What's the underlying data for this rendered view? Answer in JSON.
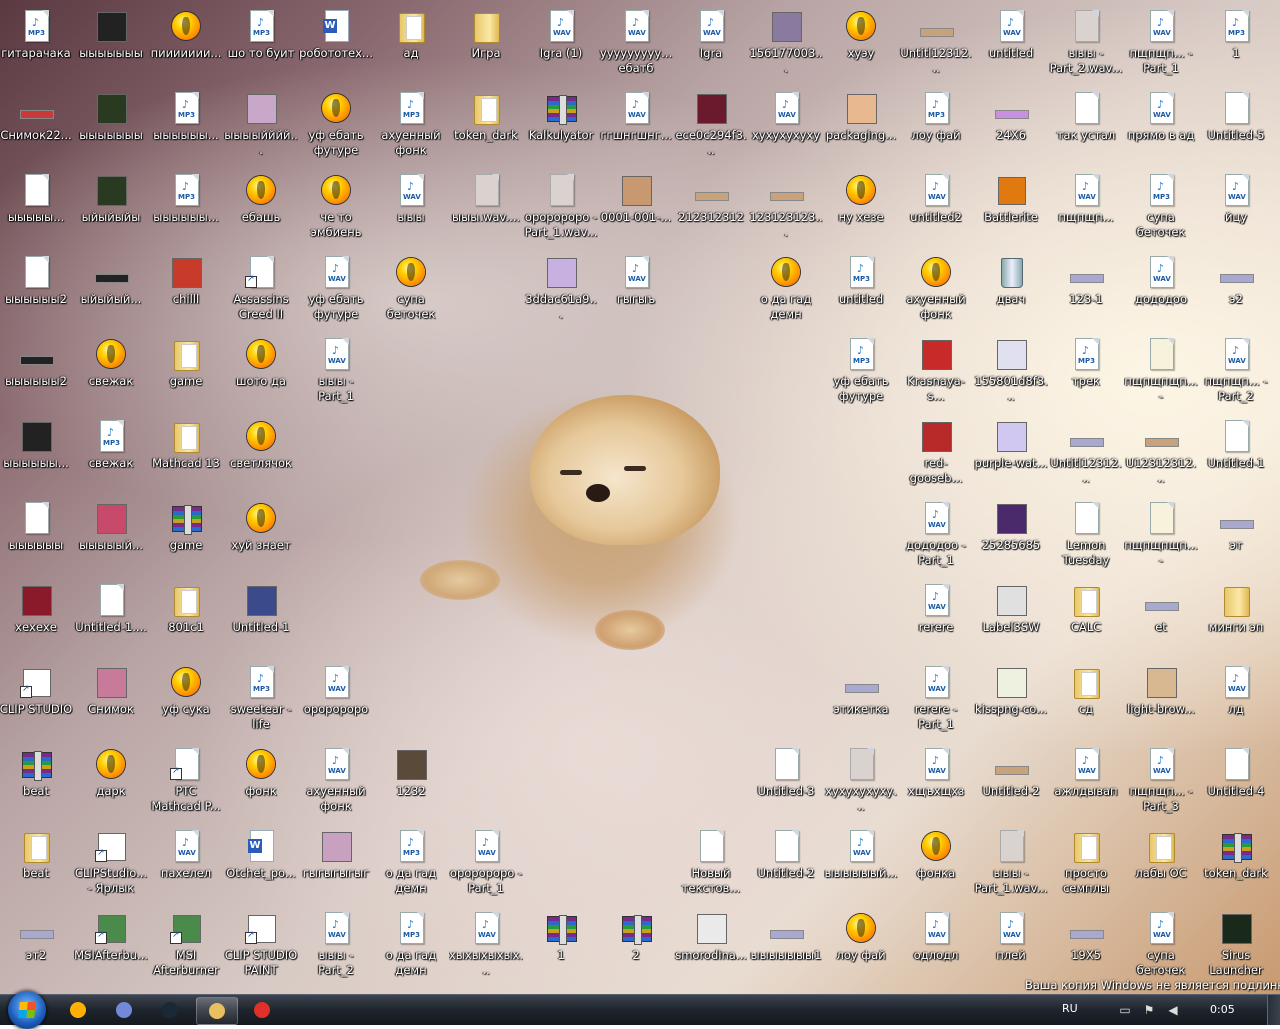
{
  "desktop": {
    "icons": [
      {
        "col": 0,
        "row": 0,
        "label": "гитарачака",
        "type": "mp3"
      },
      {
        "col": 1,
        "row": 0,
        "label": "ыыыыыыы",
        "type": "thumb",
        "color": "#222"
      },
      {
        "col": 2,
        "row": 0,
        "label": "пиииииии...",
        "type": "fl"
      },
      {
        "col": 3,
        "row": 0,
        "label": "шо то буит",
        "type": "mp3"
      },
      {
        "col": 4,
        "row": 0,
        "label": "робототех...",
        "type": "word"
      },
      {
        "col": 5,
        "row": 0,
        "label": "ад",
        "type": "folder-open"
      },
      {
        "col": 6,
        "row": 0,
        "label": "Игра",
        "type": "folder"
      },
      {
        "col": 7,
        "row": 0,
        "label": "Igra (1)",
        "type": "wav"
      },
      {
        "col": 8,
        "row": 0,
        "label": "ууууууууу... ебатб",
        "type": "wav"
      },
      {
        "col": 9,
        "row": 0,
        "label": "Igra",
        "type": "wav"
      },
      {
        "col": 10,
        "row": 0,
        "label": "156177003...",
        "type": "thumb",
        "color": "#8a7aa0"
      },
      {
        "col": 11,
        "row": 0,
        "label": "хуэу",
        "type": "fl"
      },
      {
        "col": 12,
        "row": 0,
        "label": "Untitl12312...",
        "type": "strip",
        "color": "#c8a27a"
      },
      {
        "col": 13,
        "row": 0,
        "label": "untitled",
        "type": "wav"
      },
      {
        "col": 14,
        "row": 0,
        "label": "ыыы - Part_2.wav....",
        "type": "doc-gray"
      },
      {
        "col": 15,
        "row": 0,
        "label": "пщпщп... - Part_1",
        "type": "wav"
      },
      {
        "col": 16,
        "row": 0,
        "label": "1",
        "type": "mp3"
      },
      {
        "col": 0,
        "row": 1,
        "label": "Снимок22...",
        "type": "strip",
        "color": "#c83a3a"
      },
      {
        "col": 1,
        "row": 1,
        "label": "ыыыыыыы",
        "type": "thumb",
        "color": "#2a3a20"
      },
      {
        "col": 2,
        "row": 1,
        "label": "ыыыыыы...",
        "type": "mp3"
      },
      {
        "col": 3,
        "row": 1,
        "label": "ыыыыйййй...",
        "type": "thumb",
        "color": "#c8a8c8"
      },
      {
        "col": 4,
        "row": 1,
        "label": "уф ебать футуре трап",
        "type": "fl"
      },
      {
        "col": 5,
        "row": 1,
        "label": "ахуенный фонк",
        "type": "mp3"
      },
      {
        "col": 6,
        "row": 1,
        "label": "token_dark",
        "type": "folder-open"
      },
      {
        "col": 7,
        "row": 1,
        "label": "Kalkulyator",
        "type": "rar"
      },
      {
        "col": 8,
        "row": 1,
        "label": "ггшнгшнг...",
        "type": "wav"
      },
      {
        "col": 9,
        "row": 1,
        "label": "ece0c294f3...",
        "type": "thumb",
        "color": "#6a1a2a"
      },
      {
        "col": 10,
        "row": 1,
        "label": "хухухухуху",
        "type": "wav"
      },
      {
        "col": 11,
        "row": 1,
        "label": "packaging...",
        "type": "thumb",
        "color": "#e8b890"
      },
      {
        "col": 12,
        "row": 1,
        "label": "лоу фай",
        "type": "mp3"
      },
      {
        "col": 13,
        "row": 1,
        "label": "24X6",
        "type": "strip",
        "color": "#c890e0"
      },
      {
        "col": 14,
        "row": 1,
        "label": "так устал",
        "type": "doc"
      },
      {
        "col": 15,
        "row": 1,
        "label": "прямо в ад",
        "type": "wav"
      },
      {
        "col": 16,
        "row": 1,
        "label": "Untitled-5",
        "type": "doc"
      },
      {
        "col": 0,
        "row": 2,
        "label": "ыыыыы...",
        "type": "doc"
      },
      {
        "col": 1,
        "row": 2,
        "label": "ыйыйыйы",
        "type": "thumb",
        "color": "#2a3a20"
      },
      {
        "col": 2,
        "row": 2,
        "label": "ыыыыыы...",
        "type": "mp3"
      },
      {
        "col": 3,
        "row": 2,
        "label": "ебашь",
        "type": "fl"
      },
      {
        "col": 4,
        "row": 2,
        "label": "че то эмбиень",
        "type": "fl"
      },
      {
        "col": 5,
        "row": 2,
        "label": "ыыы",
        "type": "wav"
      },
      {
        "col": 6,
        "row": 2,
        "label": "ыыы.wav....",
        "type": "doc-gray"
      },
      {
        "col": 7,
        "row": 2,
        "label": "ороророро - Part_1.wav....",
        "type": "doc-gray"
      },
      {
        "col": 8,
        "row": 2,
        "label": "0001-001-...",
        "type": "thumb",
        "color": "#c89870"
      },
      {
        "col": 9,
        "row": 2,
        "label": "212312312",
        "type": "strip",
        "color": "#c8a27a"
      },
      {
        "col": 10,
        "row": 2,
        "label": "123123123...",
        "type": "strip",
        "color": "#c8a27a"
      },
      {
        "col": 11,
        "row": 2,
        "label": "ну хезе",
        "type": "fl"
      },
      {
        "col": 12,
        "row": 2,
        "label": "untitled2",
        "type": "wav"
      },
      {
        "col": 13,
        "row": 2,
        "label": "Battlerite",
        "type": "exe",
        "color": "#e07a10"
      },
      {
        "col": 14,
        "row": 2,
        "label": "пщпщп...",
        "type": "wav"
      },
      {
        "col": 15,
        "row": 2,
        "label": "супа беточек",
        "type": "mp3"
      },
      {
        "col": 16,
        "row": 2,
        "label": "йцу",
        "type": "wav"
      },
      {
        "col": 0,
        "row": 3,
        "label": "ыыыыыы2",
        "type": "doc"
      },
      {
        "col": 1,
        "row": 3,
        "label": "ыйыйый...",
        "type": "strip",
        "color": "#222"
      },
      {
        "col": 2,
        "row": 3,
        "label": "chilll",
        "type": "thumb",
        "color": "#c83a2a"
      },
      {
        "col": 3,
        "row": 3,
        "label": "Assassins Creed II",
        "type": "shortcut-doc"
      },
      {
        "col": 4,
        "row": 3,
        "label": "уф ебать футуре трап",
        "type": "wav"
      },
      {
        "col": 5,
        "row": 3,
        "label": "супа беточек",
        "type": "fl"
      },
      {
        "col": 7,
        "row": 3,
        "label": "3ddac61a9...",
        "type": "thumb",
        "color": "#c8b0e0"
      },
      {
        "col": 8,
        "row": 3,
        "label": "гыгыъ",
        "type": "wav"
      },
      {
        "col": 10,
        "row": 3,
        "label": "о да гад демн",
        "type": "fl"
      },
      {
        "col": 11,
        "row": 3,
        "label": "untitled",
        "type": "mp3"
      },
      {
        "col": 12,
        "row": 3,
        "label": "ахуенный фонк",
        "type": "fl"
      },
      {
        "col": 13,
        "row": 3,
        "label": "двач",
        "type": "bin"
      },
      {
        "col": 14,
        "row": 3,
        "label": "123-1",
        "type": "strip",
        "color": "#a8a8d0"
      },
      {
        "col": 15,
        "row": 3,
        "label": "дододоо",
        "type": "wav"
      },
      {
        "col": 16,
        "row": 3,
        "label": "э2",
        "type": "strip",
        "color": "#a8a8d0"
      },
      {
        "col": 0,
        "row": 4,
        "label": "ыыыыыы2",
        "type": "strip",
        "color": "#222"
      },
      {
        "col": 1,
        "row": 4,
        "label": "свежак",
        "type": "fl"
      },
      {
        "col": 2,
        "row": 4,
        "label": "game",
        "type": "folder-open"
      },
      {
        "col": 3,
        "row": 4,
        "label": "шото да",
        "type": "fl"
      },
      {
        "col": 4,
        "row": 4,
        "label": "ыыы - Part_1",
        "type": "wav"
      },
      {
        "col": 11,
        "row": 4,
        "label": "уф ебать футуре трап",
        "type": "mp3"
      },
      {
        "col": 12,
        "row": 4,
        "label": "Krasnaya-s...",
        "type": "thumb",
        "color": "#c82a2a"
      },
      {
        "col": 13,
        "row": 4,
        "label": "155801d8f3...",
        "type": "thumb",
        "color": "#e0e0f0"
      },
      {
        "col": 14,
        "row": 4,
        "label": "трек",
        "type": "mp3"
      },
      {
        "col": 15,
        "row": 4,
        "label": "пщпщпщп... - Part_3.wa...",
        "type": "doc-cream"
      },
      {
        "col": 16,
        "row": 4,
        "label": "пщпщп... - Part_2",
        "type": "wav"
      },
      {
        "col": 0,
        "row": 5,
        "label": "ыыыыыы...",
        "type": "thumb",
        "color": "#222"
      },
      {
        "col": 1,
        "row": 5,
        "label": "свежак",
        "type": "mp3"
      },
      {
        "col": 2,
        "row": 5,
        "label": "Mathcad 13",
        "type": "folder-open"
      },
      {
        "col": 3,
        "row": 5,
        "label": "светлячок",
        "type": "fl"
      },
      {
        "col": 12,
        "row": 5,
        "label": "red-gooseb...",
        "type": "thumb",
        "color": "#b82a2a"
      },
      {
        "col": 13,
        "row": 5,
        "label": "purple-wat...",
        "type": "thumb",
        "color": "#d0c8f0"
      },
      {
        "col": 14,
        "row": 5,
        "label": "Untitl12312...",
        "type": "strip",
        "color": "#a8a8d0"
      },
      {
        "col": 15,
        "row": 5,
        "label": "U12312312...",
        "type": "strip",
        "color": "#c8a27a"
      },
      {
        "col": 16,
        "row": 5,
        "label": "Untitled-1",
        "type": "doc"
      },
      {
        "col": 0,
        "row": 6,
        "label": "ыыыыыы",
        "type": "doc"
      },
      {
        "col": 1,
        "row": 6,
        "label": "ыыыыый...",
        "type": "thumb",
        "color": "#c84a6a"
      },
      {
        "col": 2,
        "row": 6,
        "label": "game",
        "type": "rar"
      },
      {
        "col": 3,
        "row": 6,
        "label": "хуй знает",
        "type": "fl"
      },
      {
        "col": 12,
        "row": 6,
        "label": "дододоо - Part_1",
        "type": "wav"
      },
      {
        "col": 13,
        "row": 6,
        "label": "25285685",
        "type": "thumb",
        "color": "#4a2a6a"
      },
      {
        "col": 14,
        "row": 6,
        "label": "Lemon Tuesday",
        "type": "doc"
      },
      {
        "col": 15,
        "row": 6,
        "label": "пщпщпщп... - Part_2.wa...",
        "type": "doc-cream"
      },
      {
        "col": 16,
        "row": 6,
        "label": "эт",
        "type": "strip",
        "color": "#a8a8d0"
      },
      {
        "col": 0,
        "row": 7,
        "label": "хехехе",
        "type": "thumb",
        "color": "#8a1a2a"
      },
      {
        "col": 1,
        "row": 7,
        "label": "Untitled-1....",
        "type": "doc"
      },
      {
        "col": 2,
        "row": 7,
        "label": "801c1",
        "type": "folder-open"
      },
      {
        "col": 3,
        "row": 7,
        "label": "Untitled-1",
        "type": "thumb",
        "color": "#3a4a8a"
      },
      {
        "col": 12,
        "row": 7,
        "label": "rerere",
        "type": "wav"
      },
      {
        "col": 13,
        "row": 7,
        "label": "Label3SW",
        "type": "thumb",
        "color": "#e0e0e0"
      },
      {
        "col": 14,
        "row": 7,
        "label": "CALC",
        "type": "folder-open"
      },
      {
        "col": 15,
        "row": 7,
        "label": "et",
        "type": "strip",
        "color": "#a8a8d0"
      },
      {
        "col": 16,
        "row": 7,
        "label": "минги эп",
        "type": "folder"
      },
      {
        "col": 0,
        "row": 8,
        "label": "CLIP STUDIO",
        "type": "shortcut-exe",
        "color": "#fff"
      },
      {
        "col": 1,
        "row": 8,
        "label": "Снимок",
        "type": "thumb",
        "color": "#c87a9a"
      },
      {
        "col": 2,
        "row": 8,
        "label": "уф сука",
        "type": "fl"
      },
      {
        "col": 3,
        "row": 8,
        "label": "sweetear - life",
        "type": "mp3"
      },
      {
        "col": 4,
        "row": 8,
        "label": "ороророро",
        "type": "wav"
      },
      {
        "col": 11,
        "row": 8,
        "label": "этикетка",
        "type": "strip",
        "color": "#a8a8d0"
      },
      {
        "col": 12,
        "row": 8,
        "label": "rerere - Part_1",
        "type": "wav"
      },
      {
        "col": 13,
        "row": 8,
        "label": "kisspng-co...",
        "type": "thumb",
        "color": "#eef0e0"
      },
      {
        "col": 14,
        "row": 8,
        "label": "сд",
        "type": "folder-open"
      },
      {
        "col": 15,
        "row": 8,
        "label": "light-brow...",
        "type": "thumb",
        "color": "#d8b890"
      },
      {
        "col": 16,
        "row": 8,
        "label": "лд",
        "type": "wav"
      },
      {
        "col": 0,
        "row": 9,
        "label": "beat",
        "type": "rar"
      },
      {
        "col": 1,
        "row": 9,
        "label": "дарк",
        "type": "fl"
      },
      {
        "col": 2,
        "row": 9,
        "label": "PTC Mathcad P...",
        "type": "shortcut-doc"
      },
      {
        "col": 3,
        "row": 9,
        "label": "фонк",
        "type": "fl"
      },
      {
        "col": 4,
        "row": 9,
        "label": "ахуенный фонк",
        "type": "wav"
      },
      {
        "col": 5,
        "row": 9,
        "label": "1232",
        "type": "thumb",
        "color": "#5a4a3a"
      },
      {
        "col": 10,
        "row": 9,
        "label": "Untitled-3",
        "type": "doc"
      },
      {
        "col": 11,
        "row": 9,
        "label": "хухухухуху...",
        "type": "doc-gray"
      },
      {
        "col": 12,
        "row": 9,
        "label": "хщъхщхз",
        "type": "wav"
      },
      {
        "col": 13,
        "row": 9,
        "label": "Untitled-2",
        "type": "strip",
        "color": "#c8a27a"
      },
      {
        "col": 14,
        "row": 9,
        "label": "ажлдывап",
        "type": "wav"
      },
      {
        "col": 15,
        "row": 9,
        "label": "пщпщп... - Part_3",
        "type": "wav"
      },
      {
        "col": 16,
        "row": 9,
        "label": "Untitled-4",
        "type": "doc"
      },
      {
        "col": 0,
        "row": 10,
        "label": "beat",
        "type": "folder-open"
      },
      {
        "col": 1,
        "row": 10,
        "label": "CLIPStudio... - Ярлык",
        "type": "shortcut-exe",
        "color": "#fff"
      },
      {
        "col": 2,
        "row": 10,
        "label": "пахелел",
        "type": "wav"
      },
      {
        "col": 3,
        "row": 10,
        "label": "Otchet_po...",
        "type": "word"
      },
      {
        "col": 4,
        "row": 10,
        "label": "гыгыгыгыг",
        "type": "thumb",
        "color": "#c8a0c0"
      },
      {
        "col": 5,
        "row": 10,
        "label": "о да гад демн",
        "type": "mp3"
      },
      {
        "col": 6,
        "row": 10,
        "label": "ороророро - Part_1",
        "type": "wav"
      },
      {
        "col": 9,
        "row": 10,
        "label": "Новый текстов...",
        "type": "doc"
      },
      {
        "col": 10,
        "row": 10,
        "label": "Untitled-2",
        "type": "doc"
      },
      {
        "col": 11,
        "row": 10,
        "label": "ыыыыыый...",
        "type": "wav"
      },
      {
        "col": 12,
        "row": 10,
        "label": "фонка",
        "type": "fl"
      },
      {
        "col": 13,
        "row": 10,
        "label": "ыыы - Part_1.wav....",
        "type": "doc-gray"
      },
      {
        "col": 14,
        "row": 10,
        "label": "просто семплы",
        "type": "folder-open"
      },
      {
        "col": 15,
        "row": 10,
        "label": "лабы ОС",
        "type": "folder-open"
      },
      {
        "col": 16,
        "row": 10,
        "label": "token_dark",
        "type": "rar"
      },
      {
        "col": 0,
        "row": 11,
        "label": "эт2",
        "type": "strip",
        "color": "#a8a8d0"
      },
      {
        "col": 1,
        "row": 11,
        "label": "MSIAfterbu...",
        "type": "shortcut-exe",
        "color": "#4a8a4a"
      },
      {
        "col": 2,
        "row": 11,
        "label": "MSI Afterburner",
        "type": "shortcut-exe",
        "color": "#4a8a4a"
      },
      {
        "col": 3,
        "row": 11,
        "label": "CLIP STUDIO PAINT (64bit)",
        "type": "shortcut-exe",
        "color": "#fff"
      },
      {
        "col": 4,
        "row": 11,
        "label": "ыыы - Part_2",
        "type": "wav"
      },
      {
        "col": 5,
        "row": 11,
        "label": "о да гад демн",
        "type": "mp3"
      },
      {
        "col": 6,
        "row": 11,
        "label": "хыхыхыхых...",
        "type": "wav"
      },
      {
        "col": 7,
        "row": 11,
        "label": "1",
        "type": "rar"
      },
      {
        "col": 8,
        "row": 11,
        "label": "2",
        "type": "rar"
      },
      {
        "col": 9,
        "row": 11,
        "label": "smorodina...",
        "type": "thumb",
        "color": "#eaeaea"
      },
      {
        "col": 10,
        "row": 11,
        "label": "ыыыыыыы1",
        "type": "strip",
        "color": "#a8a8d0"
      },
      {
        "col": 11,
        "row": 11,
        "label": "лоу фай",
        "type": "fl"
      },
      {
        "col": 12,
        "row": 11,
        "label": "одлодл",
        "type": "wav"
      },
      {
        "col": 13,
        "row": 11,
        "label": "плей",
        "type": "wav"
      },
      {
        "col": 14,
        "row": 11,
        "label": "19X5",
        "type": "strip",
        "color": "#a8a8d0"
      },
      {
        "col": 15,
        "row": 11,
        "label": "супа беточек",
        "type": "wav"
      },
      {
        "col": 16,
        "row": 11,
        "label": "Sirus Launcher",
        "type": "thumb",
        "color": "#1a2a1a"
      }
    ]
  },
  "activation_text": "Ваша копия Windows не является подлинной",
  "taskbar": {
    "language": "RU",
    "clock": "0:05",
    "apps": [
      {
        "name": "fl-studio",
        "color": "#ffb000"
      },
      {
        "name": "discord",
        "color": "#7289da"
      },
      {
        "name": "steam",
        "color": "#1b2838"
      },
      {
        "name": "explorer",
        "color": "#e8c060"
      },
      {
        "name": "yandex-browser",
        "color": "#e0302a"
      }
    ]
  }
}
